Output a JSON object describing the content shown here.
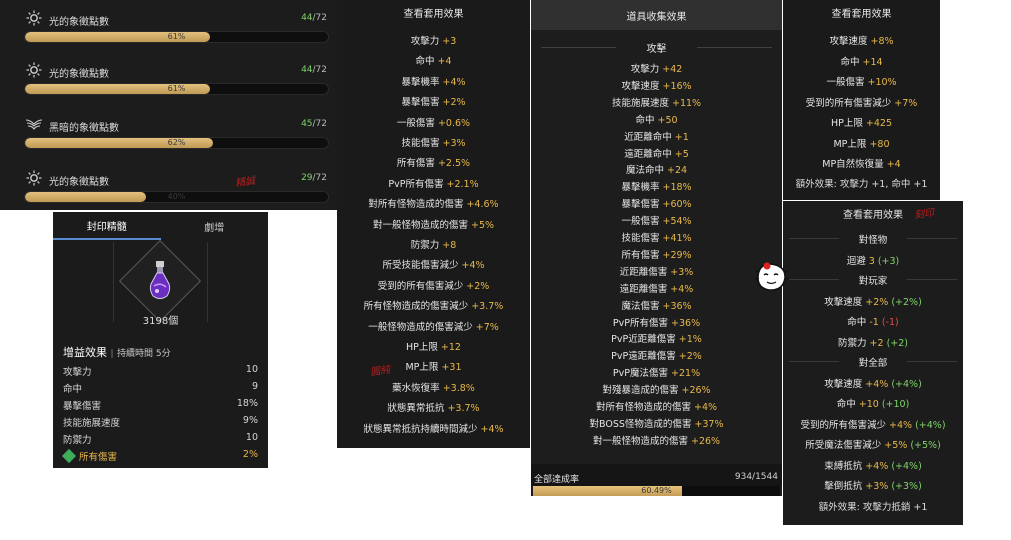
{
  "symbols": [
    {
      "icon": "sun-emblem-icon",
      "title": "光的象徵點數",
      "current": "44",
      "max": "/72",
      "percent": "61%",
      "fill": 0.61
    },
    {
      "icon": "sun-emblem-icon",
      "title": "光的象徵點數",
      "current": "44",
      "max": "/72",
      "percent": "61%",
      "fill": 0.61
    },
    {
      "icon": "dark-wing-emblem-icon",
      "title": "黑暗的象徵點數",
      "current": "45",
      "max": "/72",
      "percent": "62%",
      "fill": 0.62
    },
    {
      "icon": "sun-emblem-icon",
      "title": "光的象徵點數",
      "current": "29",
      "max": "/72",
      "percent": "40%",
      "fill": 0.4
    }
  ],
  "stamp_a": "精誠",
  "seal": {
    "tab_active": "封印精髓",
    "tab_other": "劇增",
    "item_icon": "potion-bottle-icon",
    "count": "3198個",
    "buff_title": "增益效果",
    "buff_sep": "|",
    "buff_duration": "持續時間 5分",
    "buffs": [
      {
        "label": "攻擊力",
        "value": "10"
      },
      {
        "label": "命中",
        "value": "9"
      },
      {
        "label": "暴擊傷害",
        "value": "18%"
      },
      {
        "label": "技能施展速度",
        "value": "9%"
      },
      {
        "label": "防禦力",
        "value": "10"
      },
      {
        "label": "所有傷害",
        "value": "2%",
        "highlight": true
      }
    ]
  },
  "set_c": {
    "title": "查看套用效果",
    "stamp": "圓純",
    "lines": [
      {
        "label": "攻擊力",
        "value": "+3"
      },
      {
        "label": "命中",
        "value": "+4"
      },
      {
        "label": "暴擊機率",
        "value": "+4%"
      },
      {
        "label": "暴擊傷害",
        "value": "+2%"
      },
      {
        "label": "一般傷害",
        "value": "+0.6%"
      },
      {
        "label": "技能傷害",
        "value": "+3%"
      },
      {
        "label": "所有傷害",
        "value": "+2.5%"
      },
      {
        "label": "PvP所有傷害",
        "value": "+2.1%"
      },
      {
        "label": "對所有怪物造成的傷害",
        "value": "+4.6%"
      },
      {
        "label": "對一般怪物造成的傷害",
        "value": "+5%"
      },
      {
        "label": "防禦力",
        "value": "+8"
      },
      {
        "label": "所受技能傷害減少",
        "value": "+4%"
      },
      {
        "label": "受到的所有傷害減少",
        "value": "+2%"
      },
      {
        "label": "所有怪物造成的傷害減少",
        "value": "+3.7%"
      },
      {
        "label": "一般怪物造成的傷害減少",
        "value": "+7%"
      },
      {
        "label": "HP上限",
        "value": "+12"
      },
      {
        "label": "MP上限",
        "value": "+31"
      },
      {
        "label": "藥水恢復率",
        "value": "+3.8%"
      },
      {
        "label": "狀態異常抵抗",
        "value": "+3.7%"
      },
      {
        "label": "狀態異常抵抗持續時間減少",
        "value": "+4%"
      }
    ]
  },
  "collection": {
    "title": "道具收集效果",
    "section": "攻擊",
    "lines": [
      {
        "label": "攻擊力",
        "value": "+42"
      },
      {
        "label": "攻擊速度",
        "value": "+16%"
      },
      {
        "label": "技能施展速度",
        "value": "+11%"
      },
      {
        "label": "命中",
        "value": "+50"
      },
      {
        "label": "近距離命中",
        "value": "+1"
      },
      {
        "label": "遠距離命中",
        "value": "+5"
      },
      {
        "label": "魔法命中",
        "value": "+24"
      },
      {
        "label": "暴擊機率",
        "value": "+18%"
      },
      {
        "label": "暴擊傷害",
        "value": "+60%"
      },
      {
        "label": "一般傷害",
        "value": "+54%"
      },
      {
        "label": "技能傷害",
        "value": "+41%"
      },
      {
        "label": "所有傷害",
        "value": "+29%"
      },
      {
        "label": "近距離傷害",
        "value": "+3%"
      },
      {
        "label": "遠距離傷害",
        "value": "+4%"
      },
      {
        "label": "魔法傷害",
        "value": "+36%"
      },
      {
        "label": "PvP所有傷害",
        "value": "+36%"
      },
      {
        "label": "PvP近距離傷害",
        "value": "+1%"
      },
      {
        "label": "PvP遠距離傷害",
        "value": "+2%"
      },
      {
        "label": "PvP魔法傷害",
        "value": "+21%"
      },
      {
        "label": "對殘暴造成的傷害",
        "value": "+26%"
      },
      {
        "label": "對所有怪物造成的傷害",
        "value": "+4%"
      },
      {
        "label": "對BOSS怪物造成的傷害",
        "value": "+37%"
      },
      {
        "label": "對一般怪物造成的傷害",
        "value": "+26%"
      }
    ],
    "total_label": "全部達成率",
    "total_count": "934/1544",
    "total_pct": "60.49%",
    "total_fill": 0.6049
  },
  "set_e": {
    "title": "查看套用效果",
    "lines": [
      {
        "label": "攻擊速度",
        "value": "+8%"
      },
      {
        "label": "命中",
        "value": "+14"
      },
      {
        "label": "一般傷害",
        "value": "+10%"
      },
      {
        "label": "受到的所有傷害減少",
        "value": "+7%"
      },
      {
        "label": "HP上限",
        "value": "+425"
      },
      {
        "label": "MP上限",
        "value": "+80"
      },
      {
        "label": "MP自然恢復量",
        "value": "+4"
      }
    ],
    "extra": "額外效果: 攻擊力 +1, 命中 +1"
  },
  "set_f": {
    "title": "查看套用效果",
    "stamp": "刻印",
    "groups": [
      {
        "name": "對怪物",
        "lines": [
          {
            "label": "迴避",
            "value": "3",
            "delta": "(+3)",
            "delta_color": "green"
          }
        ]
      },
      {
        "name": "對玩家",
        "lines": [
          {
            "label": "攻擊速度",
            "value": "+2%",
            "delta": "(+2%)",
            "delta_color": "green"
          },
          {
            "label": "命中",
            "value": "-1",
            "delta": "(-1)",
            "delta_color": "red"
          },
          {
            "label": "防禦力",
            "value": "+2",
            "delta": "(+2)",
            "delta_color": "green"
          }
        ]
      },
      {
        "name": "對全部",
        "lines": [
          {
            "label": "攻擊速度",
            "value": "+4%",
            "delta": "(+4%)",
            "delta_color": "green"
          },
          {
            "label": "命中",
            "value": "+10",
            "delta": "(+10)",
            "delta_color": "green"
          },
          {
            "label": "受到的所有傷害減少",
            "value": "+4%",
            "delta": "(+4%)",
            "delta_color": "green"
          },
          {
            "label": "所受魔法傷害減少",
            "value": "+5%",
            "delta": "(+5%)",
            "delta_color": "green"
          },
          {
            "label": "束縛抵抗",
            "value": "+4%",
            "delta": "(+4%)",
            "delta_color": "green"
          },
          {
            "label": "擊倒抵抗",
            "value": "+3%",
            "delta": "(+3%)",
            "delta_color": "green"
          }
        ]
      }
    ],
    "extra": "額外效果: 攻擊力抵銷 +1"
  },
  "colors": {
    "gold": "#e8b84a",
    "green": "#7fd46a",
    "red": "#e84a4a",
    "bar_fill": "#d6b06a"
  }
}
